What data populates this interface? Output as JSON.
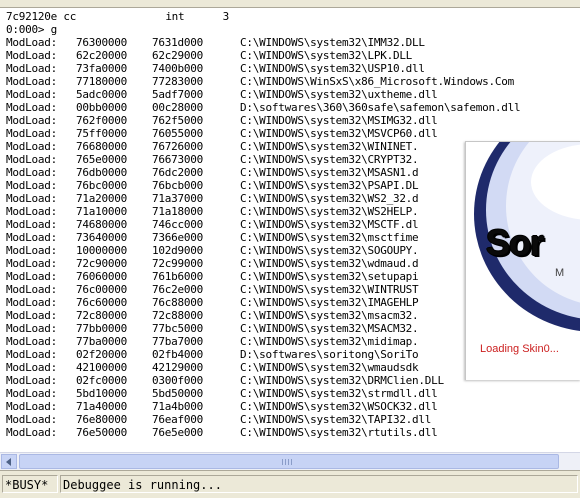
{
  "console": {
    "header_line": "7c92120e cc              int      3",
    "prompt_line": "0:000> g",
    "modules": [
      {
        "prefix": "ModLoad:",
        "start": "76300000",
        "end": "7631d000",
        "path": "C:\\WINDOWS\\system32\\IMM32.DLL"
      },
      {
        "prefix": "ModLoad:",
        "start": "62c20000",
        "end": "62c29000",
        "path": "C:\\WINDOWS\\system32\\LPK.DLL"
      },
      {
        "prefix": "ModLoad:",
        "start": "73fa0000",
        "end": "7400b000",
        "path": "C:\\WINDOWS\\system32\\USP10.dll"
      },
      {
        "prefix": "ModLoad:",
        "start": "77180000",
        "end": "77283000",
        "path": "C:\\WINDOWS\\WinSxS\\x86_Microsoft.Windows.Com"
      },
      {
        "prefix": "ModLoad:",
        "start": "5adc0000",
        "end": "5adf7000",
        "path": "C:\\WINDOWS\\system32\\uxtheme.dll"
      },
      {
        "prefix": "ModLoad:",
        "start": "00bb0000",
        "end": "00c28000",
        "path": "D:\\softwares\\360\\360safe\\safemon\\safemon.dll"
      },
      {
        "prefix": "ModLoad:",
        "start": "762f0000",
        "end": "762f5000",
        "path": "C:\\WINDOWS\\system32\\MSIMG32.dll"
      },
      {
        "prefix": "ModLoad:",
        "start": "75ff0000",
        "end": "76055000",
        "path": "C:\\WINDOWS\\system32\\MSVCP60.dll"
      },
      {
        "prefix": "ModLoad:",
        "start": "76680000",
        "end": "76726000",
        "path": "C:\\WINDOWS\\system32\\WININET."
      },
      {
        "prefix": "ModLoad:",
        "start": "765e0000",
        "end": "76673000",
        "path": "C:\\WINDOWS\\system32\\CRYPT32."
      },
      {
        "prefix": "ModLoad:",
        "start": "76db0000",
        "end": "76dc2000",
        "path": "C:\\WINDOWS\\system32\\MSASN1.d"
      },
      {
        "prefix": "ModLoad:",
        "start": "76bc0000",
        "end": "76bcb000",
        "path": "C:\\WINDOWS\\system32\\PSAPI.DL"
      },
      {
        "prefix": "ModLoad:",
        "start": "71a20000",
        "end": "71a37000",
        "path": "C:\\WINDOWS\\system32\\WS2_32.d"
      },
      {
        "prefix": "ModLoad:",
        "start": "71a10000",
        "end": "71a18000",
        "path": "C:\\WINDOWS\\system32\\WS2HELP."
      },
      {
        "prefix": "ModLoad:",
        "start": "74680000",
        "end": "746cc000",
        "path": "C:\\WINDOWS\\system32\\MSCTF.dl"
      },
      {
        "prefix": "ModLoad:",
        "start": "73640000",
        "end": "7366e000",
        "path": "C:\\WINDOWS\\system32\\msctfime"
      },
      {
        "prefix": "ModLoad:",
        "start": "10000000",
        "end": "102d9000",
        "path": "C:\\WINDOWS\\system32\\SOGOUPY."
      },
      {
        "prefix": "ModLoad:",
        "start": "72c90000",
        "end": "72c99000",
        "path": "C:\\WINDOWS\\system32\\wdmaud.d"
      },
      {
        "prefix": "ModLoad:",
        "start": "76060000",
        "end": "761b6000",
        "path": "C:\\WINDOWS\\system32\\setupapi"
      },
      {
        "prefix": "ModLoad:",
        "start": "76c00000",
        "end": "76c2e000",
        "path": "C:\\WINDOWS\\system32\\WINTRUST"
      },
      {
        "prefix": "ModLoad:",
        "start": "76c60000",
        "end": "76c88000",
        "path": "C:\\WINDOWS\\system32\\IMAGEHLP"
      },
      {
        "prefix": "ModLoad:",
        "start": "72c80000",
        "end": "72c88000",
        "path": "C:\\WINDOWS\\system32\\msacm32."
      },
      {
        "prefix": "ModLoad:",
        "start": "77bb0000",
        "end": "77bc5000",
        "path": "C:\\WINDOWS\\system32\\MSACM32."
      },
      {
        "prefix": "ModLoad:",
        "start": "77ba0000",
        "end": "77ba7000",
        "path": "C:\\WINDOWS\\system32\\midimap."
      },
      {
        "prefix": "ModLoad:",
        "start": "02f20000",
        "end": "02fb4000",
        "path": "D:\\softwares\\soritong\\SoriTo"
      },
      {
        "prefix": "ModLoad:",
        "start": "42100000",
        "end": "42129000",
        "path": "C:\\WINDOWS\\system32\\wmaudsdk"
      },
      {
        "prefix": "ModLoad:",
        "start": "02fc0000",
        "end": "0300f000",
        "path": "C:\\WINDOWS\\system32\\DRMClien.DLL"
      },
      {
        "prefix": "ModLoad:",
        "start": "5bd10000",
        "end": "5bd50000",
        "path": "C:\\WINDOWS\\system32\\strmdll.dll"
      },
      {
        "prefix": "ModLoad:",
        "start": "71a40000",
        "end": "71a4b000",
        "path": "C:\\WINDOWS\\system32\\WSOCK32.dll"
      },
      {
        "prefix": "ModLoad:",
        "start": "76e80000",
        "end": "76eaf000",
        "path": "C:\\WINDOWS\\system32\\TAPI32.dll"
      },
      {
        "prefix": "ModLoad:",
        "start": "76e50000",
        "end": "76e5e000",
        "path": "C:\\WINDOWS\\system32\\rtutils.dll"
      }
    ]
  },
  "splash": {
    "logo_text": "Sor",
    "subtext": "M",
    "status_text": "Loading Skin0...",
    "colors": {
      "status": "#cc2020",
      "arc_dark": "#1f2a6b",
      "arc_light": "#b9c4ec"
    }
  },
  "status_bar": {
    "busy_label": "*BUSY*",
    "message": "Debuggee is running..."
  },
  "icons": {
    "scroll_left": "arrow-left-icon",
    "scroll_grip": "grip-icon"
  }
}
